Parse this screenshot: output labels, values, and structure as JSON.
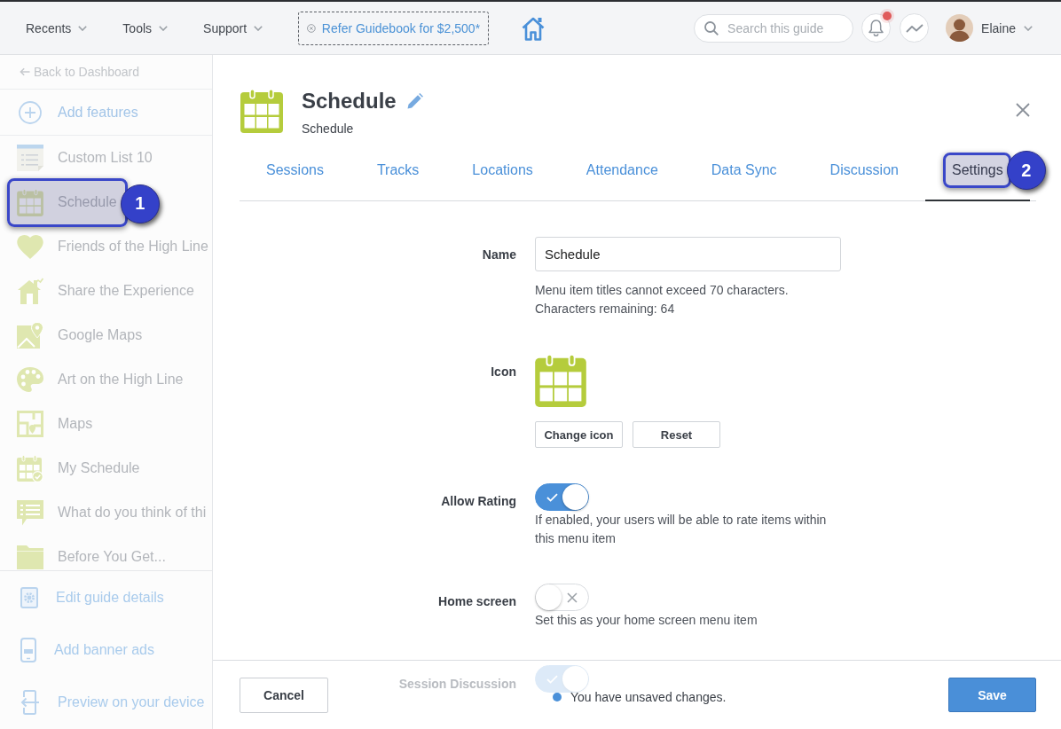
{
  "top_bar": {
    "menus": [
      {
        "label": "Recents"
      },
      {
        "label": "Tools"
      },
      {
        "label": "Support"
      }
    ],
    "promo": {
      "label": "Refer Guidebook for $2,500*"
    },
    "search": {
      "placeholder": "Search this guide"
    },
    "notifications": {
      "unread": true
    },
    "user": {
      "name": "Elaine"
    }
  },
  "sidebar": {
    "back_link": {
      "label": "Back to Dashboard"
    },
    "add_features": {
      "label": "Add features"
    },
    "items": [
      {
        "label": "Custom List 10"
      },
      {
        "label": "Schedule",
        "callout": "1"
      },
      {
        "label": "Friends of the High Line"
      },
      {
        "label": "Share the Experience"
      },
      {
        "label": "Google Maps"
      },
      {
        "label": "Art on the High Line"
      },
      {
        "label": "Maps"
      },
      {
        "label": "My Schedule"
      },
      {
        "label": "What do you think of thi"
      },
      {
        "label": "Before You Get..."
      }
    ],
    "actions": [
      {
        "label": "Edit guide details"
      },
      {
        "label": "Add banner ads"
      },
      {
        "label": "Preview on your device"
      }
    ]
  },
  "panel": {
    "title": "Schedule",
    "subtitle": "Schedule",
    "tabs": [
      {
        "label": "Sessions",
        "selected": false
      },
      {
        "label": "Tracks",
        "selected": false
      },
      {
        "label": "Locations",
        "selected": false
      },
      {
        "label": "Attendance",
        "selected": false
      },
      {
        "label": "Data Sync",
        "selected": false
      },
      {
        "label": "Discussion",
        "selected": false
      },
      {
        "label": "Settings",
        "selected": true,
        "callout": "2"
      }
    ],
    "form": {
      "rows": [
        {
          "kind": "text",
          "label": "Name",
          "value": "Schedule",
          "obscured": false,
          "help": [
            "Menu item titles cannot exceed 70 characters.",
            "Characters remaining: 64"
          ]
        },
        {
          "kind": "icon",
          "label": "Icon",
          "obscured": false,
          "buttons": [
            {
              "label": "Change icon"
            },
            {
              "label": "Reset"
            }
          ]
        },
        {
          "kind": "toggle",
          "label": "Allow Rating",
          "on": true,
          "obscured": false,
          "help": [
            "If enabled, your users will be able to rate items within this menu item"
          ]
        },
        {
          "kind": "toggle",
          "label": "Home screen",
          "on": false,
          "obscured": false,
          "help": [
            "Set this as your home screen menu item"
          ]
        },
        {
          "kind": "toggle",
          "label": "Session Discussion",
          "on": true,
          "obscured": true
        }
      ]
    }
  },
  "footer": {
    "cancel": {
      "label": "Cancel"
    },
    "status": "You have unsaved changes.",
    "save": {
      "label": "Save"
    }
  }
}
